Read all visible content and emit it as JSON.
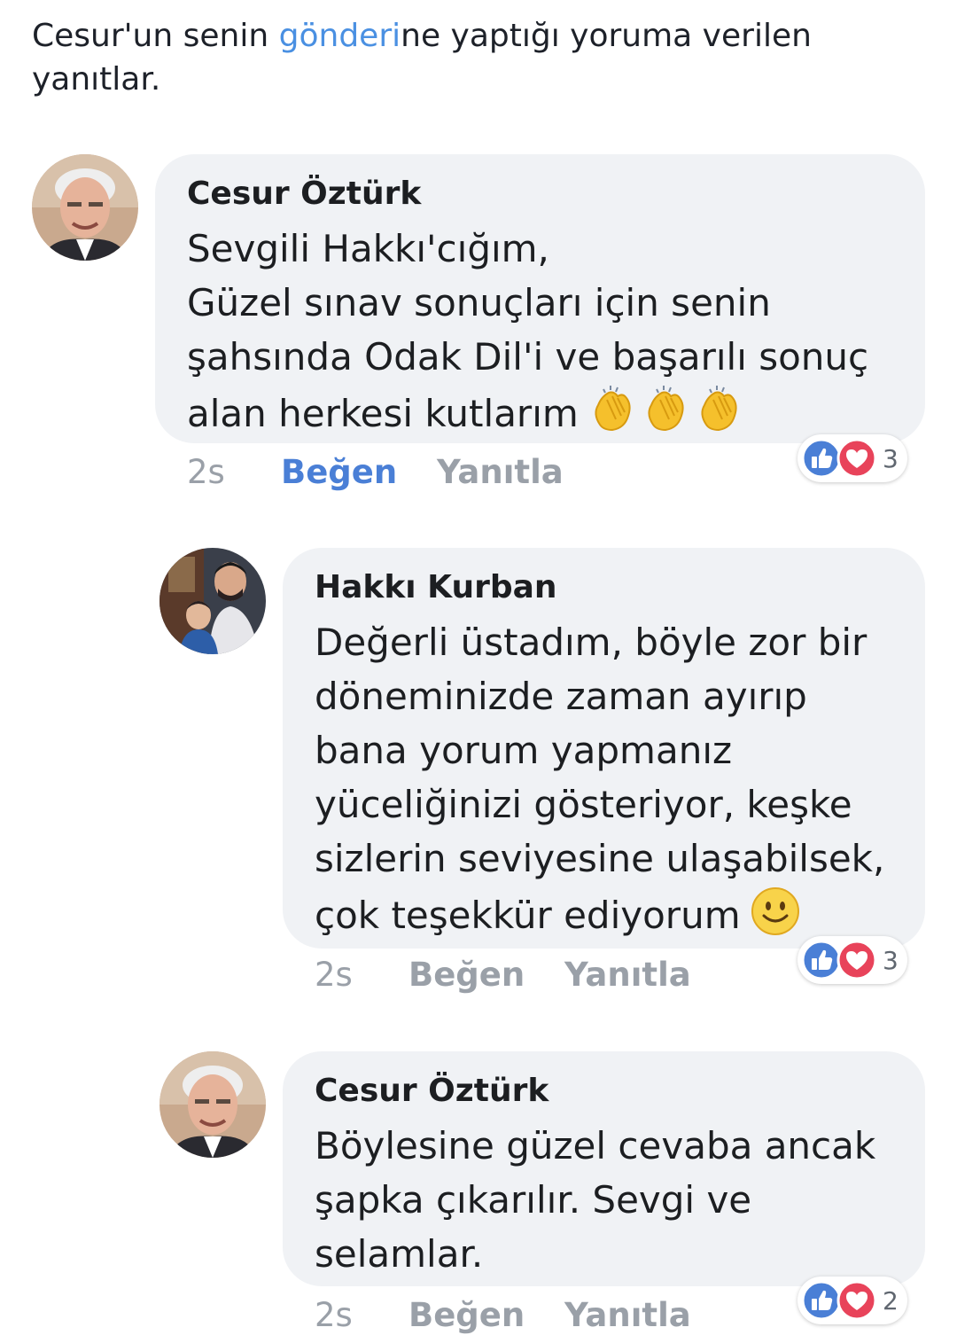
{
  "header": {
    "prefix": "Cesur'un senin ",
    "link": "gönderi",
    "suffix": "ne yaptığı yoruma verilen",
    "line2": "yanıtlar."
  },
  "comments": [
    {
      "author": "Cesur Öztürk",
      "lines": [
        "Sevgili Hakkı'cığım,",
        "Güzel sınav sonuçları için senin",
        "şahsında Odak Dil'i ve başarılı sonuç",
        "alan herkesi kutlarım"
      ],
      "emoji": [
        "clapping-hands",
        "clapping-hands",
        "clapping-hands"
      ],
      "time": "2s",
      "like": "Beğen",
      "like_active": true,
      "reply": "Yanıtla",
      "reaction_count": "3"
    },
    {
      "author": "Hakkı Kurban",
      "lines": [
        "Değerli üstadım, böyle zor bir",
        "döneminizde zaman ayırıp",
        "bana yorum yapmanız",
        "yüceliğinizi gösteriyor, keşke",
        "sizlerin seviyesine ulaşabilsek,",
        "çok teşekkür ediyorum"
      ],
      "emoji": [
        "smiling-face"
      ],
      "time": "2s",
      "like": "Beğen",
      "like_active": false,
      "reply": "Yanıtla",
      "reaction_count": "3"
    },
    {
      "author": "Cesur Öztürk",
      "lines": [
        "Böylesine güzel cevaba ancak",
        "şapka çıkarılır. Sevgi ve",
        "selamlar."
      ],
      "time": "2s",
      "like": "Beğen",
      "like_active": false,
      "reply": "Yanıtla",
      "reaction_count": "2"
    }
  ],
  "colors": {
    "link": "#4a90e2",
    "like_active": "#4a7fd6",
    "bubble": "#f0f2f5",
    "like_reaction": "#4a7fd6",
    "love_reaction": "#e8435a"
  },
  "icons": {
    "like_reaction": "thumbs-up-icon",
    "love_reaction": "heart-icon"
  }
}
